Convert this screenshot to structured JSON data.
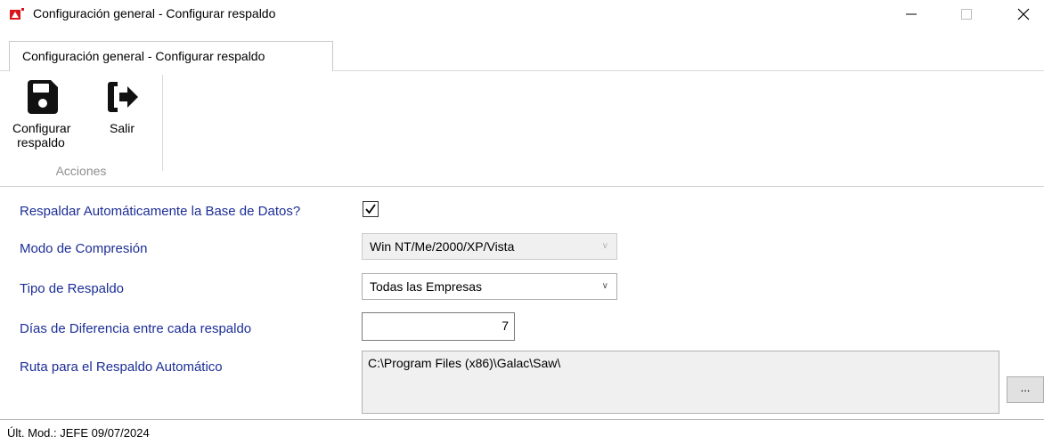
{
  "window": {
    "title": "Configuración general - Configurar respaldo",
    "icon": "app-logo-icon",
    "controls": {
      "minimize": "—",
      "maximize": "☐",
      "close": "✕"
    }
  },
  "tab": {
    "label": "Configuración general - Configurar respaldo"
  },
  "ribbon": {
    "save": {
      "label_line1": "Configurar",
      "label_line2": "respaldo",
      "icon": "floppy-disk-icon"
    },
    "exit": {
      "label": "Salir",
      "icon": "sign-out-icon"
    },
    "group_label": "Acciones"
  },
  "form": {
    "auto_backup": {
      "label": "Respaldar Automáticamente la Base de Datos?",
      "checked": true
    },
    "compression": {
      "label": "Modo de Compresión",
      "value": "Win NT/Me/2000/XP/Vista",
      "enabled": false
    },
    "backup_type": {
      "label": "Tipo de Respaldo",
      "value": "Todas las Empresas"
    },
    "days": {
      "label": "Días de Diferencia entre cada respaldo",
      "value": "7"
    },
    "path": {
      "label": "Ruta para el Respaldo Automático",
      "value": "C:\\Program Files (x86)\\Galac\\Saw\\",
      "browse_label": "..."
    }
  },
  "status": {
    "text": "Últ. Mod.:  JEFE  09/07/2024"
  },
  "colors": {
    "label": "#1c2e96",
    "disabled_bg": "#f0f0f0",
    "group_label": "#8f8f8f"
  }
}
